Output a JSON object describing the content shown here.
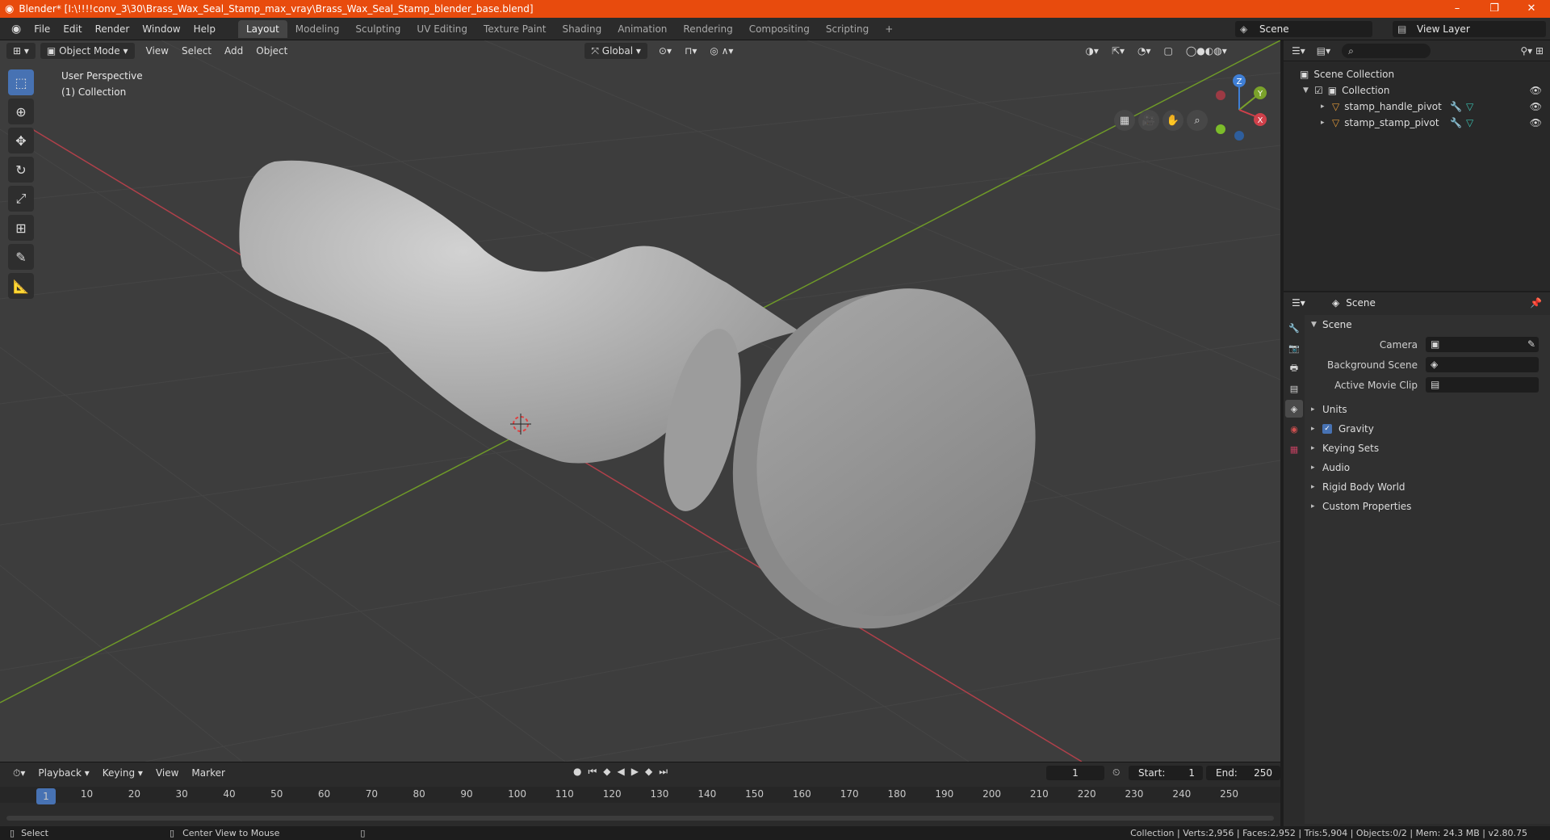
{
  "titlebar": {
    "title": "Blender* [I:\\!!!!conv_3\\30\\Brass_Wax_Seal_Stamp_max_vray\\Brass_Wax_Seal_Stamp_blender_base.blend]",
    "minimize": "–",
    "restore": "❐",
    "close": "✕"
  },
  "menu": {
    "file": "File",
    "edit": "Edit",
    "render": "Render",
    "window": "Window",
    "help": "Help"
  },
  "workspaces": [
    "Layout",
    "Modeling",
    "Sculpting",
    "UV Editing",
    "Texture Paint",
    "Shading",
    "Animation",
    "Rendering",
    "Compositing",
    "Scripting"
  ],
  "add_workspace": "+",
  "scene_name": "Scene",
  "view_layer": "View Layer",
  "viewport": {
    "mode": "Object Mode",
    "view": "View",
    "select": "Select",
    "add": "Add",
    "object": "Object",
    "orientation": "Global",
    "info_line1": "User Perspective",
    "info_line2": "(1) Collection",
    "gizmo_x": "X",
    "gizmo_y": "Y",
    "gizmo_z": "Z"
  },
  "timeline": {
    "playback": "Playback",
    "keying": "Keying",
    "view": "View",
    "marker": "Marker",
    "current_frame": "1",
    "start_label": "Start:",
    "start_value": "1",
    "end_label": "End:",
    "end_value": "250",
    "ticks": [
      "1",
      "10",
      "20",
      "30",
      "40",
      "50",
      "60",
      "70",
      "80",
      "90",
      "100",
      "110",
      "120",
      "130",
      "140",
      "150",
      "160",
      "170",
      "180",
      "190",
      "200",
      "210",
      "220",
      "230",
      "240",
      "250"
    ]
  },
  "outliner": {
    "scene_collection": "Scene Collection",
    "collection": "Collection",
    "items": [
      "stamp_handle_pivot",
      "stamp_stamp_pivot"
    ]
  },
  "properties": {
    "header": "Scene",
    "section_scene": "Scene",
    "camera_label": "Camera",
    "bg_scene_label": "Background Scene",
    "movie_clip_label": "Active Movie Clip",
    "subsections": [
      "Units",
      "Gravity",
      "Keying Sets",
      "Audio",
      "Rigid Body World",
      "Custom Properties"
    ]
  },
  "statusbar": {
    "select": "Select",
    "center_view": "Center View to Mouse",
    "stats": "Collection | Verts:2,956 | Faces:2,952 | Tris:5,904 | Objects:0/2 | Mem: 24.3 MB | v2.80.75"
  },
  "colors": {
    "accent": "#4772b3",
    "titlebar": "#e84b0d",
    "x_axis": "#c0404a",
    "y_axis": "#7aa22a"
  }
}
